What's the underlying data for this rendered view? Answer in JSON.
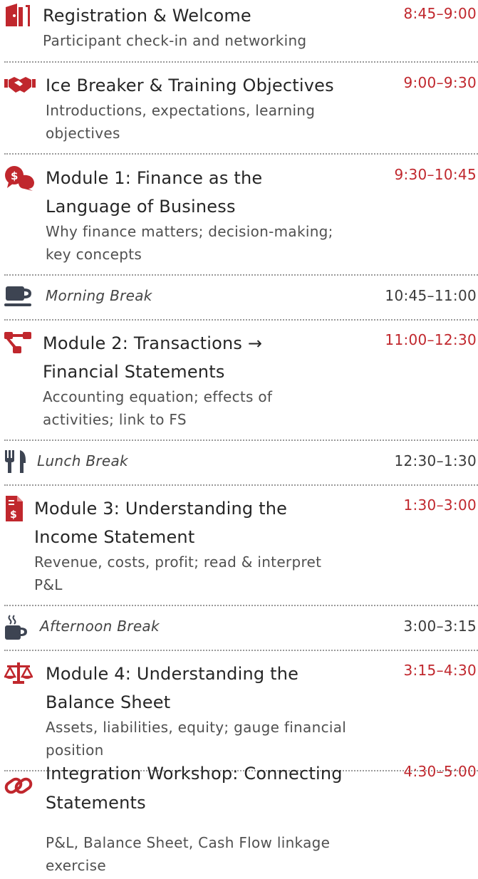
{
  "sessions": [
    {
      "title": "Registration & Welcome",
      "desc_lines": [
        "Participant check-in and networking"
      ],
      "time": "8:45–9:00",
      "icon": "door-icon"
    },
    {
      "title": "Ice Breaker & Training Objectives",
      "desc_lines": [
        "Introductions, expectations, learning",
        "objectives"
      ],
      "time": "9:00–9:30",
      "icon": "handshake-icon"
    },
    {
      "title_lines": [
        "Module 1: Finance as the",
        "Language of Business"
      ],
      "desc_lines": [
        "Why finance matters; decision-making;",
        "key concepts"
      ],
      "time": "9:30–10:45",
      "icon": "money-chat-icon"
    },
    {
      "title_lines": [
        "Module 2: Transactions →",
        "Financial Statements"
      ],
      "desc_lines": [
        "Accounting equation; effects of",
        "activities; link to FS"
      ],
      "time": "11:00–12:30",
      "icon": "flow-nodes-icon"
    },
    {
      "title_lines": [
        "Module 3: Understanding the",
        "Income Statement"
      ],
      "desc_lines": [
        "Revenue, costs, profit; read & interpret",
        "P&L"
      ],
      "time": "1:30–3:00",
      "icon": "invoice-dollar-icon"
    },
    {
      "title_lines": [
        "Module 4: Understanding the",
        "Balance Sheet"
      ],
      "desc_lines": [
        "Assets, liabilities, equity; gauge financial",
        "position"
      ],
      "time": "3:15–4:30",
      "icon": "scale-icon"
    },
    {
      "title_lines": [
        "Integration Workshop: Connecting",
        "Statements"
      ],
      "desc_lines": [
        "P&L, Balance Sheet, Cash Flow linkage",
        "exercise"
      ],
      "time": "4:30–5:00",
      "icon": "link-icon"
    }
  ],
  "breaks": [
    {
      "label": "Morning Break",
      "time": "10:45–11:00",
      "icon": "mug-icon"
    },
    {
      "label": "Lunch Break",
      "time": "12:30–1:30",
      "icon": "utensils-icon"
    },
    {
      "label": "Afternoon Break",
      "time": "3:00–3:15",
      "icon": "hot-coffee-icon"
    }
  ],
  "colors": {
    "accent": "#c0272d",
    "break_icon": "#3d4452"
  }
}
